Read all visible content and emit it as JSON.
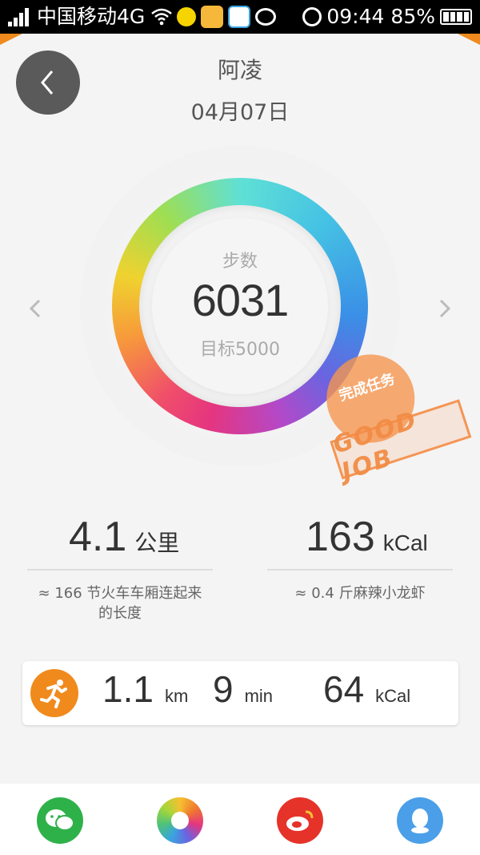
{
  "status_bar": {
    "carrier": "中国移动4G",
    "time": "09:44",
    "battery": "85%"
  },
  "header": {
    "title": "阿凌",
    "date": "04月07日"
  },
  "steps": {
    "label": "步数",
    "value": "6031",
    "goal": "目标5000"
  },
  "badge": {
    "top_text": "完成任务",
    "bottom_text": "GOOD JOB"
  },
  "stats": {
    "distance": {
      "value": "4.1",
      "unit": "公里",
      "note_line1": "≈ 166  节火车车厢连起来",
      "note_line2": "的长度"
    },
    "calories": {
      "value": "163",
      "unit": "kCal",
      "note_line1": "≈ 0.4 斤麻辣小龙虾"
    }
  },
  "activity": {
    "distance": {
      "value": "1.1",
      "unit": "km"
    },
    "duration": {
      "value": "9",
      "unit": "min"
    },
    "calories": {
      "value": "64",
      "unit": "kCal"
    }
  },
  "share": [
    "wechat-icon",
    "moments-icon",
    "weibo-icon",
    "qq-icon"
  ],
  "colors": {
    "accent_orange": "#f08a1c",
    "wechat": "#2fb14a",
    "weibo": "#e5332a",
    "qq": "#4a9fe8"
  }
}
